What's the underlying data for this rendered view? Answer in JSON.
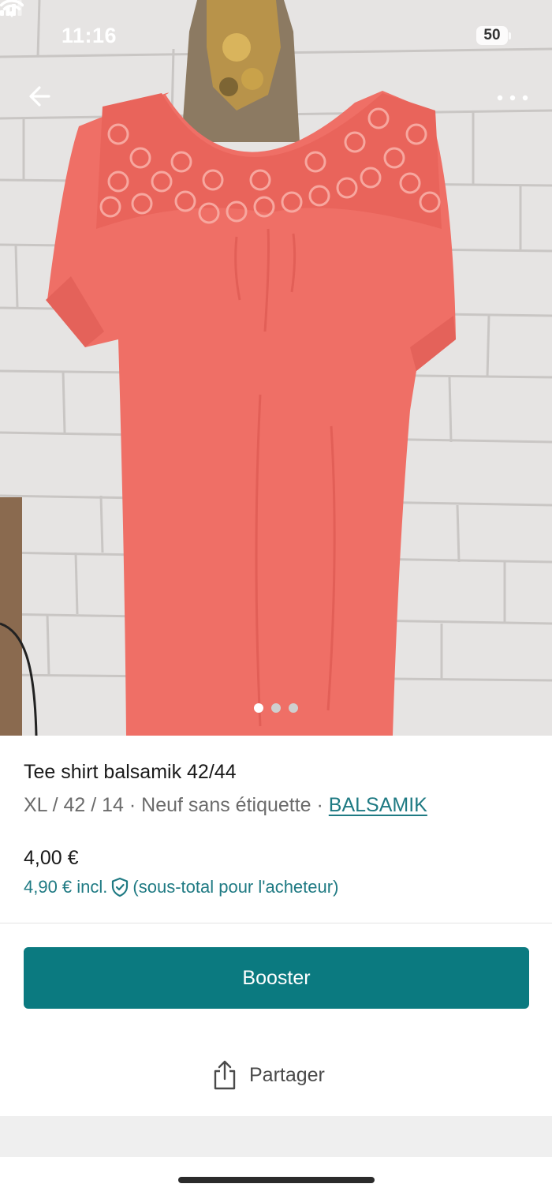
{
  "status_bar": {
    "time": "11:16",
    "battery": "50"
  },
  "gallery": {
    "image_description": "coral-pink-lace-yoke-top-on-mannequin",
    "dots": [
      {
        "active": true
      },
      {
        "active": false
      },
      {
        "active": false
      }
    ],
    "colors": {
      "dot_active": "#ffffff",
      "dot_inactive": "#cfcfcf"
    }
  },
  "nav": {
    "back_icon": "arrow-left-icon",
    "more_icon": "more-horizontal-icon"
  },
  "item": {
    "title": "Tee shirt balsamik 42/44",
    "details": "XL / 42 / 14 · Neuf sans étiquette · ",
    "brand": "BALSAMIK",
    "price": "4,00 €",
    "price_incl": "4,90 € incl.",
    "buyer_note": "(sous-total pour l'acheteur)"
  },
  "actions": {
    "booster_label": "Booster",
    "share_label": "Partager"
  },
  "colors": {
    "accent": "#0b7a80",
    "link": "#1f7a83",
    "text": "#1a1a1a",
    "muted": "#6b6b6b"
  }
}
